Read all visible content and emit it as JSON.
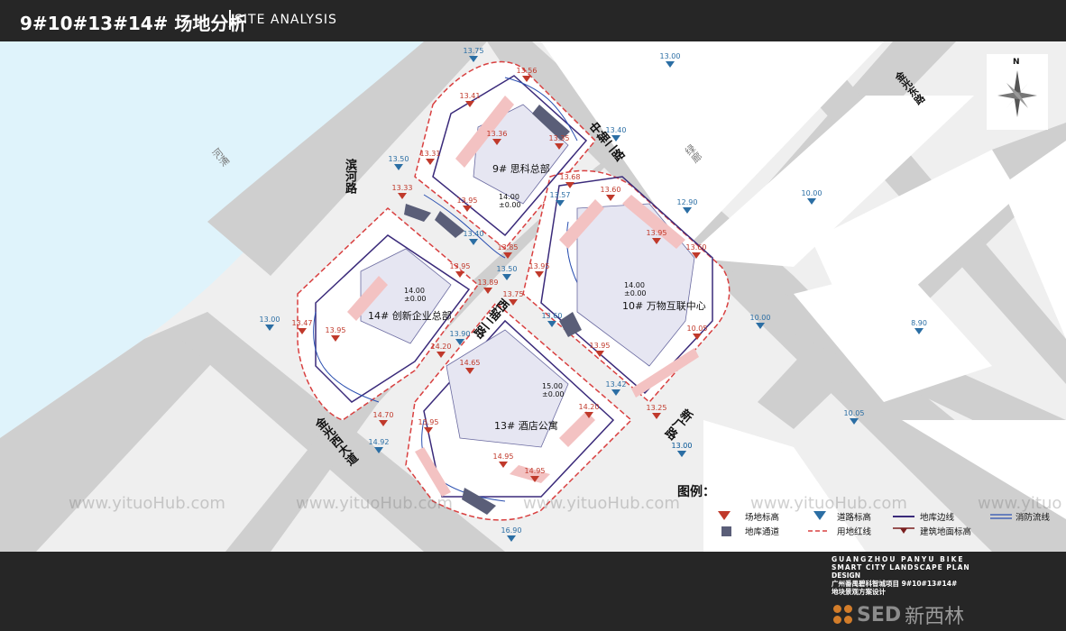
{
  "header": {
    "title_cn": "9#10#13#14# 场地分析",
    "title_en": "SITE ANALYSIS"
  },
  "parcels": {
    "p9": "9# 思科总部",
    "p10": "10# 万物互联中心",
    "p13": "13# 酒店公寓",
    "p14": "14# 创新企业总部"
  },
  "roads": {
    "binhe": "滨河路",
    "zhongzhou2": "中轴二路",
    "xizhou2": "西轴二路",
    "jinguangxi": "金光西大道",
    "jinguangdong": "金光东路",
    "xinguang": "新广路",
    "river": "河涌",
    "green": "绿廊"
  },
  "building_elevations": {
    "p9": [
      "14.00",
      "±0.00"
    ],
    "p10": [
      "14.00",
      "±0.00"
    ],
    "p13": [
      "15.00",
      "±0.00"
    ],
    "p14": [
      "14.00",
      "±0.00"
    ]
  },
  "site_levels": [
    "13.56",
    "13.41",
    "13.36",
    "13.31",
    "13.35",
    "13.33",
    "13.95",
    "13.85",
    "13.68",
    "13.60",
    "13.95",
    "13.60",
    "13.95",
    "13.89",
    "13.95",
    "13.47",
    "13.95",
    "13.75",
    "14.20",
    "14.65",
    "14.20",
    "13.95",
    "14.95",
    "14.95",
    "14.70",
    "10.05",
    "13.95",
    "13.25"
  ],
  "road_levels": [
    "13.75",
    "13.40",
    "13.50",
    "13.57",
    "13.40",
    "13.50",
    "13.60",
    "13.90",
    "13.42",
    "13.00",
    "16.90",
    "14.92",
    "13.00",
    "12.90",
    "10.00",
    "10.00",
    "8.90",
    "10.05",
    "13.00",
    "13.00"
  ],
  "legend": {
    "title": "图例：",
    "site_level": "场地标高",
    "road_level": "道路标高",
    "garage_edge": "地库边线",
    "fire_route": "消防流线",
    "garage_access": "地库通道",
    "red_line": "用地红线",
    "building_level": "建筑地面标高"
  },
  "compass": {
    "north": "N"
  },
  "watermarks": [
    "www.yituoHub.com",
    "www.yituoHub.com",
    "www.yituoHub.com",
    "www.yituoHub.com",
    "www.yituo"
  ],
  "footer": {
    "en1": "GUANGZHOU PANYU BIKE",
    "en2": "SMART CITY LANDSCAPE PLAN",
    "en3": "DESIGN",
    "cn1": "广州番禺碧科智城项目 9#10#13#14#",
    "cn2": "地块景观方案设计",
    "logo": "SED",
    "logo_cn": "新西林"
  },
  "colors": {
    "site_marker": "#c0392b",
    "road_marker": "#2b6ea4",
    "garage_edge": "#3a2a7a",
    "fire_route": "#2a4fb0",
    "red_line": "#d94040",
    "river": "#dff3fb"
  }
}
